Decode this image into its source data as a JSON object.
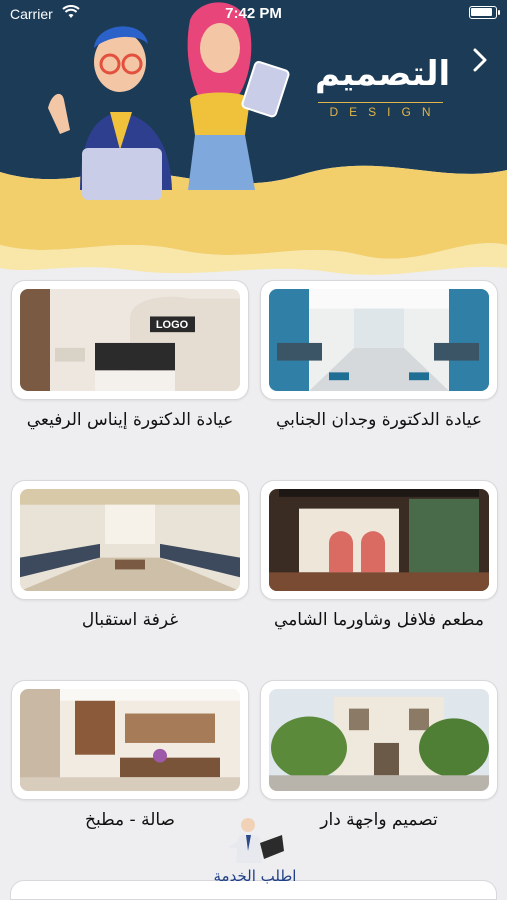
{
  "status_bar": {
    "carrier": "Carrier",
    "time": "7:42 PM"
  },
  "header": {
    "title_arabic": "التصميم",
    "title_english": "DESIGN",
    "back_icon": "chevron-right-icon",
    "colors": {
      "navy": "#1c3b57",
      "gold": "#f3cf6b",
      "cream": "#f8e7a9"
    }
  },
  "cards": [
    {
      "title": "عيادة الدكتورة وجدان الجنابي",
      "image": "clinic-waiting-room-photo"
    },
    {
      "title": "عيادة الدكتورة إيناس الرفيعي",
      "image": "clinic-reception-photo"
    },
    {
      "title": "مطعم فلافل وشاورما الشامي",
      "image": "restaurant-interior-photo"
    },
    {
      "title": "غرفة استقبال",
      "image": "majlis-reception-room-photo"
    },
    {
      "title": "تصميم واجهة دار",
      "image": "house-facade-photo"
    },
    {
      "title": "صالة - مطبخ",
      "image": "kitchen-living-photo"
    }
  ],
  "request_service": {
    "label": "اطلب الخدمة",
    "icon": "businessman-laptop-icon",
    "label_color": "#1f3f86"
  }
}
